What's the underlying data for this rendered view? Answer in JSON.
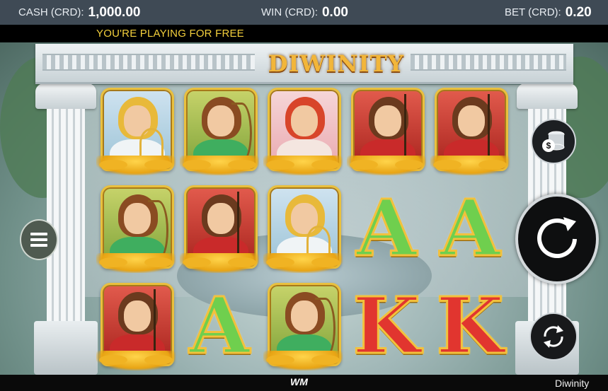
{
  "topbar": {
    "cash_label": "CASH (CRD):",
    "cash_value": "1,000.00",
    "win_label": "WIN (CRD):",
    "win_value": "0.00",
    "bet_label": "BET (CRD):",
    "bet_value": "0.20"
  },
  "notice": "YOU'RE PLAYING FOR FREE",
  "logo_text": "DIWINITY",
  "reels": [
    [
      "apollo",
      "artemis",
      "athena"
    ],
    [
      "artemis",
      "athena",
      "letter-A"
    ],
    [
      "aphrodite",
      "apollo",
      "artemis"
    ],
    [
      "athena",
      "letter-A",
      "letter-K"
    ],
    [
      "athena",
      "letter-A",
      "letter-K"
    ]
  ],
  "symbol_letters": {
    "letter-A": "A",
    "letter-K": "K"
  },
  "colors": {
    "gold": "#e9c03e",
    "notice": "#f3cf3c",
    "letter_A": "#6fcf4e",
    "letter_K": "#e1352f"
  },
  "icons": {
    "menu": "hamburger-menu-icon",
    "bet": "coin-stack-icon",
    "spin": "spin-arrow-icon",
    "autoplay": "autoplay-arrows-icon"
  },
  "footer": {
    "brand": "WM",
    "game_name": "Diwinity"
  }
}
